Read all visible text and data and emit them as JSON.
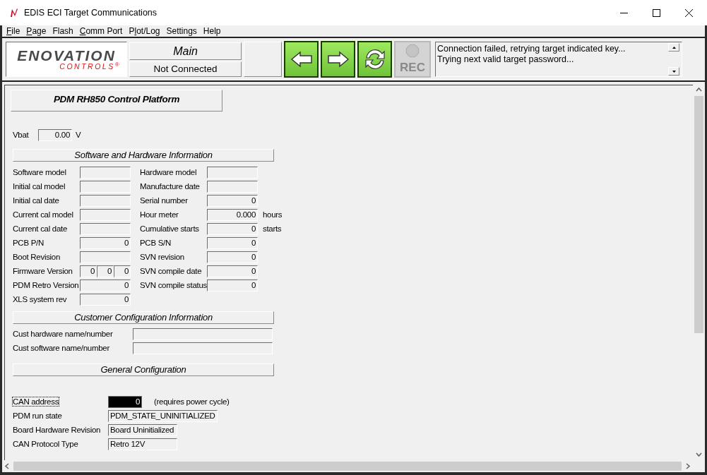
{
  "window": {
    "title": "EDIS ECI Target Communications"
  },
  "menu": [
    {
      "key": "F",
      "rest": "ile"
    },
    {
      "key": "P",
      "rest": "age"
    },
    {
      "rest": "Flash"
    },
    {
      "key": "C",
      "rest": "omm Port"
    },
    {
      "prefix": "P",
      "key": "l",
      "rest": "ot/Log"
    },
    {
      "rest": "Settings"
    },
    {
      "rest": "Help"
    }
  ],
  "logo": {
    "name": "ENOVATION",
    "tagline": "CONTROLS$^{®}$"
  },
  "page_title": "Main",
  "connection_status": "Not Connected",
  "toolbar_buttons": [
    {
      "kind": "back",
      "disabled": false
    },
    {
      "kind": "forward",
      "disabled": false
    },
    {
      "kind": "refresh",
      "disabled": false
    },
    {
      "kind": "record",
      "label": "REC",
      "disabled": true
    }
  ],
  "messages": [
    "Connection failed, retrying target indicated key...",
    "Trying next valid target password..."
  ],
  "platform_title": "PDM RH850 Control Platform",
  "vbat": {
    "label": "Vbat",
    "value": "0.00",
    "unit": "V"
  },
  "sw_hw_info": {
    "title": "Software and Hardware Information",
    "left": [
      {
        "label": "Software model"
      },
      {
        "label": "Initial cal model"
      },
      {
        "label": "Initial cal date"
      },
      {
        "label": "Current cal model"
      },
      {
        "label": "Current cal date"
      },
      {
        "label": "PCB P/N",
        "value": "0"
      },
      {
        "label": "Boot Revision"
      },
      {
        "label": "Firmware Version",
        "parts": [
          "0",
          "0",
          "0"
        ]
      },
      {
        "label": "PDM Retro Version",
        "value": "0"
      },
      {
        "label": "XLS system rev",
        "value": "0"
      }
    ],
    "right": [
      {
        "label": "Hardware model"
      },
      {
        "label": "Manufacture date"
      },
      {
        "label": "Serial number",
        "value": "0"
      },
      {
        "label": "Hour meter",
        "value": "0.000",
        "unit": "hours"
      },
      {
        "label": "Cumulative starts",
        "value": "0",
        "unit": "starts"
      },
      {
        "label": "PCB S/N",
        "value": "0"
      },
      {
        "label": "SVN revision",
        "value": "0"
      },
      {
        "label": "SVN compile date",
        "value": "0"
      },
      {
        "label": "SVN compile status",
        "value": "0"
      }
    ]
  },
  "customer_config": {
    "title": "Customer Configuration Information",
    "fields": [
      {
        "label": "Cust hardware name/number"
      },
      {
        "label": "Cust software name/number"
      }
    ]
  },
  "general_config": {
    "title": "General Configuration",
    "fields": [
      {
        "label": "CAN address",
        "value": "0",
        "note": "(requires power cycle)",
        "selected": true,
        "kind": "number"
      },
      {
        "label": "PDM run state",
        "value": "PDM_STATE_UNINITIALIZED",
        "selected": false,
        "kind": "text"
      },
      {
        "label": "Board Hardware Revision",
        "value": "Board Uninitialized",
        "selected": false,
        "kind": "text"
      },
      {
        "label": "CAN Protocol Type",
        "value": "Retro 12V",
        "selected": false,
        "kind": "text"
      }
    ]
  }
}
